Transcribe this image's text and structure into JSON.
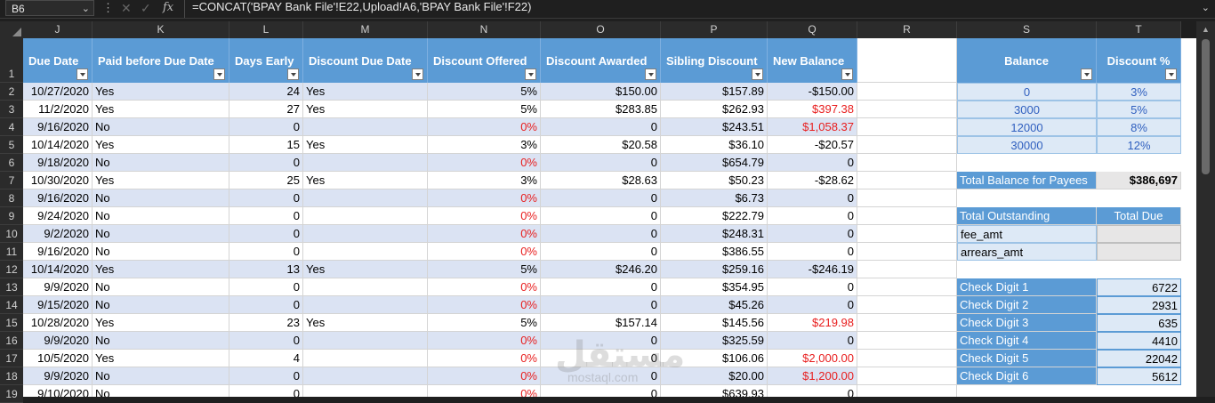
{
  "formula_bar": {
    "name_box": "B6",
    "formula": "=CONCAT('BPAY Bank File'!E22,Upload!A6,'BPAY Bank File'!F22)",
    "fx_label": "fx",
    "cancel_icon": "close-icon",
    "enter_icon": "check-icon"
  },
  "columns": [
    "J",
    "K",
    "L",
    "M",
    "N",
    "O",
    "P",
    "Q",
    "R",
    "S",
    "T"
  ],
  "rows": [
    "1",
    "2",
    "3",
    "4",
    "5",
    "6",
    "7",
    "8",
    "9",
    "10",
    "11",
    "12",
    "13",
    "14",
    "15",
    "16",
    "17",
    "18",
    "19"
  ],
  "table": {
    "headers": [
      "Due Date",
      "Paid before Due Date",
      "Days Early",
      "Discount Due Date",
      "Discount Offered",
      "Discount Awarded",
      "Sibling Discount",
      "New Balance"
    ],
    "data": [
      [
        "10/27/2020",
        "Yes",
        "24",
        "Yes",
        "5%",
        "$150.00",
        "$157.89",
        "-$150.00"
      ],
      [
        "11/2/2020",
        "Yes",
        "27",
        "Yes",
        "5%",
        "$283.85",
        "$262.93",
        "$397.38"
      ],
      [
        "9/16/2020",
        "No",
        "0",
        "",
        "0%",
        "0",
        "$243.51",
        "$1,058.37"
      ],
      [
        "10/14/2020",
        "Yes",
        "15",
        "Yes",
        "3%",
        "$20.58",
        "$36.10",
        "-$20.57"
      ],
      [
        "9/18/2020",
        "No",
        "0",
        "",
        "0%",
        "0",
        "$654.79",
        "0"
      ],
      [
        "10/30/2020",
        "Yes",
        "25",
        "Yes",
        "3%",
        "$28.63",
        "$50.23",
        "-$28.62"
      ],
      [
        "9/16/2020",
        "No",
        "0",
        "",
        "0%",
        "0",
        "$6.73",
        "0"
      ],
      [
        "9/24/2020",
        "No",
        "0",
        "",
        "0%",
        "0",
        "$222.79",
        "0"
      ],
      [
        "9/2/2020",
        "No",
        "0",
        "",
        "0%",
        "0",
        "$248.31",
        "0"
      ],
      [
        "9/16/2020",
        "No",
        "0",
        "",
        "0%",
        "0",
        "$386.55",
        "0"
      ],
      [
        "10/14/2020",
        "Yes",
        "13",
        "Yes",
        "5%",
        "$246.20",
        "$259.16",
        "-$246.19"
      ],
      [
        "9/9/2020",
        "No",
        "0",
        "",
        "0%",
        "0",
        "$354.95",
        "0"
      ],
      [
        "9/15/2020",
        "No",
        "0",
        "",
        "0%",
        "0",
        "$45.26",
        "0"
      ],
      [
        "10/28/2020",
        "Yes",
        "23",
        "Yes",
        "5%",
        "$157.14",
        "$145.56",
        "$219.98"
      ],
      [
        "9/9/2020",
        "No",
        "0",
        "",
        "0%",
        "0",
        "$325.59",
        "0"
      ],
      [
        "10/5/2020",
        "Yes",
        "4",
        "",
        "0%",
        "0",
        "$106.06",
        "$2,000.00"
      ],
      [
        "9/9/2020",
        "No",
        "0",
        "",
        "0%",
        "0",
        "$20.00",
        "$1,200.00"
      ],
      [
        "9/10/2020",
        "No",
        "0",
        "",
        "0%",
        "0",
        "$639.93",
        "0"
      ]
    ],
    "red_balance_rows": [
      1,
      2,
      13,
      15,
      16
    ]
  },
  "discount_table": {
    "headers": [
      "Balance",
      "Discount %"
    ],
    "rows": [
      [
        "0",
        "3%"
      ],
      [
        "3000",
        "5%"
      ],
      [
        "12000",
        "8%"
      ],
      [
        "30000",
        "12%"
      ]
    ]
  },
  "total_balance": {
    "label": "Total Balance for Payees",
    "value": "$386,697"
  },
  "outstanding": {
    "header_left": "Total Outstanding",
    "header_right": "Total Due",
    "rows": [
      "fee_amt",
      "arrears_amt"
    ]
  },
  "check_digits": [
    [
      "Check Digit 1",
      "6722"
    ],
    [
      "Check Digit 2",
      "2931"
    ],
    [
      "Check Digit 3",
      "635"
    ],
    [
      "Check Digit 4",
      "4410"
    ],
    [
      "Check Digit 5",
      "22042"
    ],
    [
      "Check Digit 6",
      "5612"
    ]
  ],
  "watermark": {
    "main": "مستقل",
    "sub": "mostaql.com"
  },
  "colors": {
    "header_blue": "#5b9bd5",
    "band": "#dbe3f3",
    "negative_red": "#e81e1e"
  }
}
